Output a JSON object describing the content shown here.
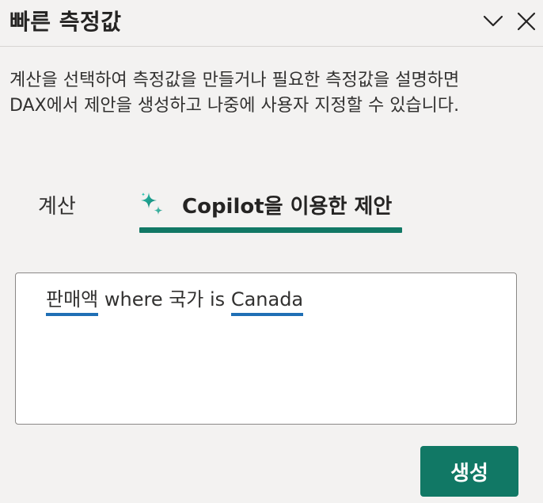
{
  "header": {
    "title": "빠른 측정값"
  },
  "description": "계산을 선택하여 측정값을 만들거나 필요한 측정값을 설명하면 DAX에서 제안을 생성하고 나중에 사용자 지정할 수 있습니다.",
  "tabs": {
    "calculations": {
      "label": "계산"
    },
    "copilot": {
      "label": "Copilot을 이용한 제안",
      "selected": true,
      "icon": "copilot-sparkle-icon"
    }
  },
  "prompt": {
    "token_1": "판매액",
    "text_1": " where 국가 is ",
    "token_2": "Canada"
  },
  "actions": {
    "generate_label": "생성"
  },
  "colors": {
    "accent": "#117865",
    "token_underline": "#1f6fb5",
    "background": "#f3f2f1"
  }
}
